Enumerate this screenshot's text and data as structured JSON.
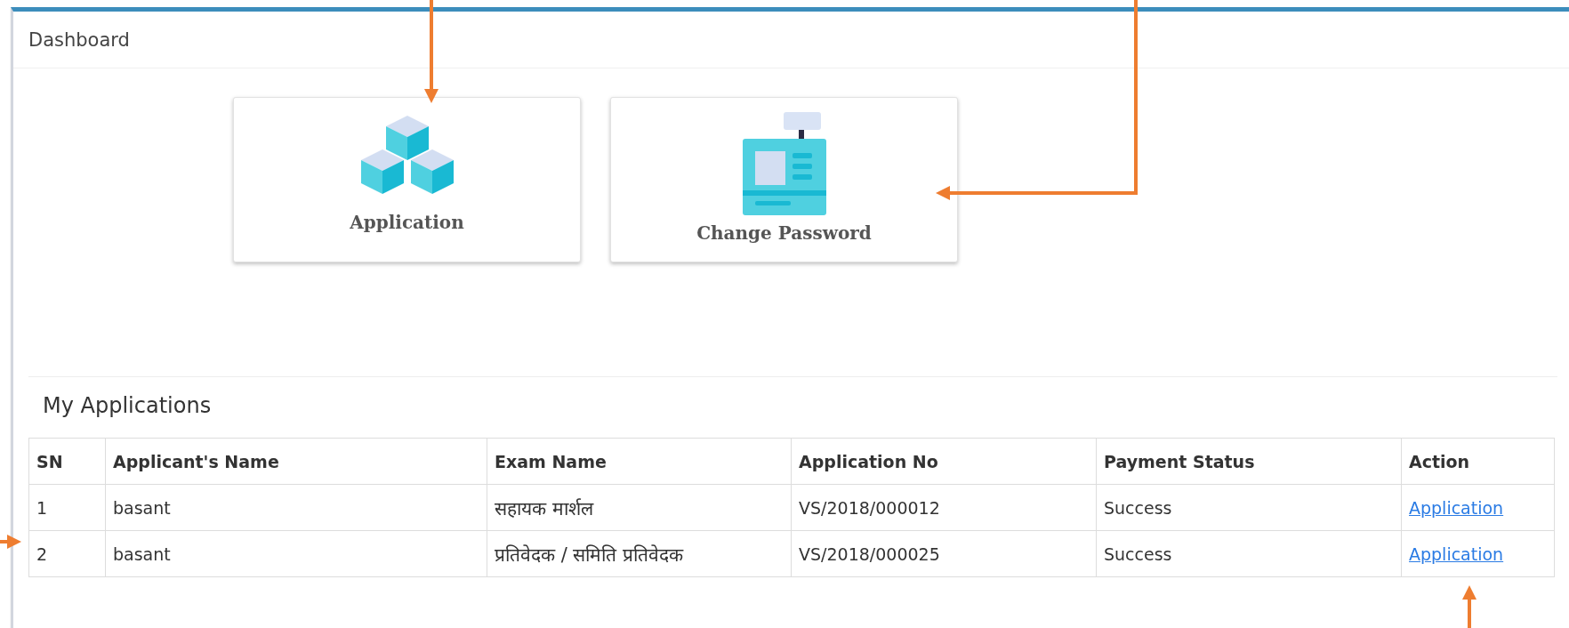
{
  "panel": {
    "title": "Dashboard"
  },
  "tiles": [
    {
      "kind": "cubes",
      "label": "Application"
    },
    {
      "kind": "machine",
      "label": "Change Password"
    }
  ],
  "applications": {
    "title": "My Applications",
    "columns": [
      "SN",
      "Applicant's Name",
      "Exam Name",
      "Application No",
      "Payment Status",
      "Action"
    ],
    "rows": [
      {
        "sn": "1",
        "name": "basant",
        "exam": "सहायक मार्शल",
        "number": "VS/2018/000012",
        "payment": "Success",
        "action": "Application"
      },
      {
        "sn": "2",
        "name": "basant",
        "exam": "प्रतिवेदक / समिति प्रतिवेदक",
        "number": "VS/2018/000025",
        "payment": "Success",
        "action": "Application"
      }
    ]
  }
}
